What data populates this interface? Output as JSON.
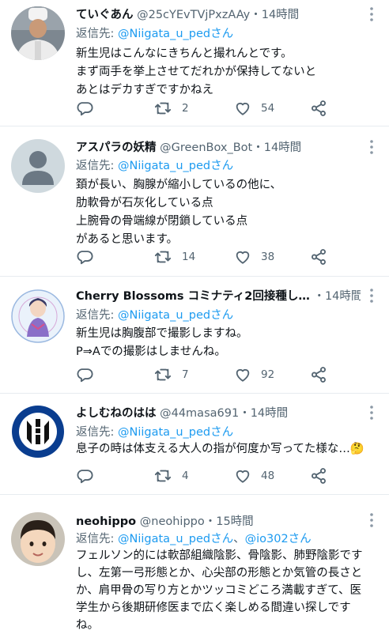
{
  "tweets": [
    {
      "name": "ていぐあん",
      "handle": "@25cYEvTVjPxzAAy",
      "time": "14時間",
      "reply_prefix": "返信先: ",
      "reply_to": "@Niigata_u_pedさん",
      "reply_to2": "",
      "lines": [
        "新生児はこんなにきちんと撮れんとです。",
        "まず両手を挙上させてだれかが保持してないと",
        "あとはデカすぎですかねえ"
      ],
      "retweets": "2",
      "likes": "54"
    },
    {
      "name": "アスパラの妖精",
      "handle": "@GreenBox_Bot",
      "time": "14時間",
      "reply_prefix": "返信先: ",
      "reply_to": "@Niigata_u_pedさん",
      "reply_to2": "",
      "lines": [
        "頚が長い、胸腺が縮小しているの他に、",
        "肋軟骨が石灰化している点",
        "上腕骨の骨端線が閉鎖している点",
        "があると思います。"
      ],
      "retweets": "14",
      "likes": "38"
    },
    {
      "name": "Cherry Blossoms コミナティ2回接種し…",
      "handle": "",
      "time": "14時間",
      "reply_prefix": "返信先: ",
      "reply_to": "@Niigata_u_pedさん",
      "reply_to2": "",
      "lines": [
        "新生児は胸腹部で撮影しますね。",
        "P⇒Aでの撮影はしませんね。"
      ],
      "retweets": "7",
      "likes": "92"
    },
    {
      "name": "よしむねのはは",
      "handle": "@44masa691",
      "time": "14時間",
      "reply_prefix": "返信先: ",
      "reply_to": "@Niigata_u_pedさん",
      "reply_to2": "",
      "lines": [
        "息子の時は体支える大人の指が何度か写ってた様な…🤔"
      ],
      "retweets": "4",
      "likes": "48"
    },
    {
      "name": "neohippo",
      "handle": "@neohippo",
      "time": "15時間",
      "reply_prefix": "返信先: ",
      "reply_to": "@Niigata_u_pedさん",
      "reply_to2": "@io302さん",
      "lines": [
        "フェルソン的には軟部組織陰影、骨陰影、肺野陰影です",
        "し、左第一弓形態とか、心尖部の形態とか気管の長さと",
        "か、肩甲骨の写り方とかツッコミどころ満載すぎて、医",
        "学生から後期研修医まで広く楽しめる間違い探しです",
        "ね。"
      ],
      "retweets": "",
      "likes": ""
    }
  ],
  "separator": "・",
  "reply_joiner": "、",
  "icons": {
    "reply": "reply-icon",
    "retweet": "retweet-icon",
    "like": "like-icon",
    "share": "share-icon",
    "more": "more-options-icon"
  },
  "colors": {
    "link": "#1d9bf0",
    "muted": "#536471",
    "text": "#0f1419"
  }
}
